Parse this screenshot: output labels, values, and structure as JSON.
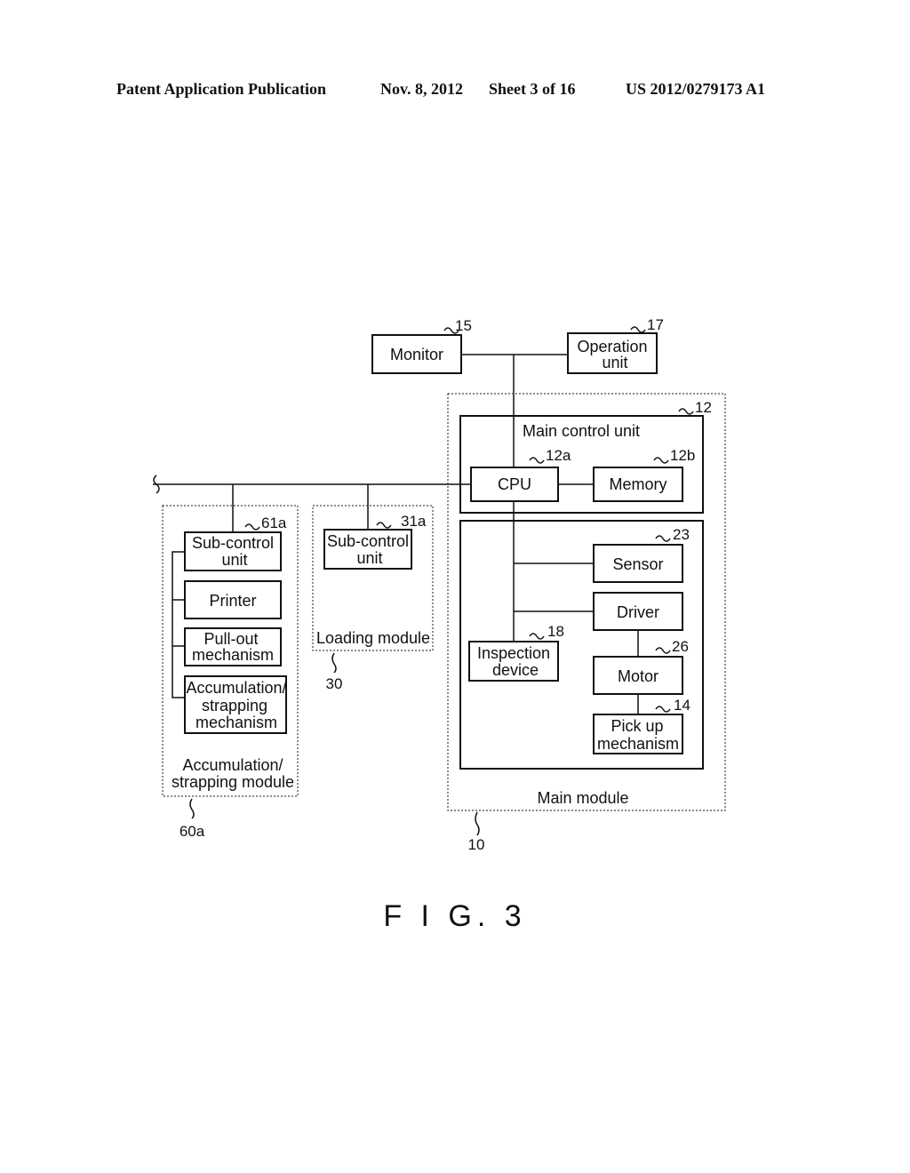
{
  "header": {
    "publication": "Patent Application Publication",
    "date": "Nov. 8, 2012",
    "sheet": "Sheet 3 of 16",
    "number": "US 2012/0279173 A1"
  },
  "figure_label": "F I G. 3",
  "nodes": {
    "monitor": {
      "label": "Monitor",
      "ref": "15"
    },
    "operation_unit": {
      "label_1": "Operation",
      "label_2": "unit",
      "ref": "17"
    },
    "main_control_unit": {
      "label": "Main control unit",
      "ref": "12"
    },
    "cpu": {
      "label": "CPU",
      "ref": "12a"
    },
    "memory": {
      "label": "Memory",
      "ref": "12b"
    },
    "sensor": {
      "label": "Sensor",
      "ref": "23"
    },
    "driver": {
      "label": "Driver"
    },
    "inspection_device": {
      "label_1": "Inspection",
      "label_2": "device",
      "ref": "18"
    },
    "motor": {
      "label": "Motor",
      "ref": "26"
    },
    "pickup": {
      "label_1": "Pick up",
      "label_2": "mechanism",
      "ref": "14"
    },
    "main_module": {
      "label": "Main module",
      "ref": "10"
    },
    "loading_sub_control": {
      "label_1": "Sub-control",
      "label_2": "unit",
      "ref": "31a"
    },
    "loading_module": {
      "label": "Loading module",
      "ref": "30"
    },
    "accum_sub_control": {
      "label_1": "Sub-control",
      "label_2": "unit",
      "ref": "61a"
    },
    "printer": {
      "label": "Printer"
    },
    "pullout": {
      "label_1": "Pull-out",
      "label_2": "mechanism"
    },
    "accum_strap_mech": {
      "label_1": "Accumulation/",
      "label_2": "strapping",
      "label_3": "mechanism"
    },
    "accum_module": {
      "label_1": "Accumulation/",
      "label_2": "strapping module",
      "ref": "60a"
    }
  }
}
